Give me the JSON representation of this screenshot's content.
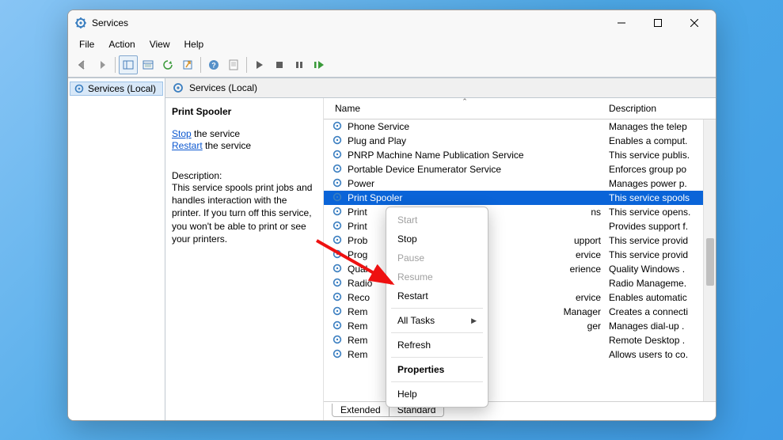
{
  "window": {
    "title": "Services"
  },
  "menu": {
    "file": "File",
    "action": "Action",
    "view": "View",
    "help": "Help"
  },
  "tree": {
    "root": "Services (Local)"
  },
  "paneHeader": "Services (Local)",
  "detail": {
    "title": "Print Spooler",
    "stop_link": "Stop",
    "stop_suffix": " the service",
    "restart_link": "Restart",
    "restart_suffix": " the service",
    "desc_head": "Description:",
    "desc_body": "This service spools print jobs and handles interaction with the printer. If you turn off this service, you won't be able to print or see your printers."
  },
  "columns": {
    "name": "Name",
    "description": "Description"
  },
  "services": [
    {
      "name": "Phone Service",
      "desc": "Manages the telep"
    },
    {
      "name": "Plug and Play",
      "desc": "Enables a comput."
    },
    {
      "name": "PNRP Machine Name Publication Service",
      "desc": "This service publis."
    },
    {
      "name": "Portable Device Enumerator Service",
      "desc": "Enforces group po"
    },
    {
      "name": "Power",
      "desc": "Manages power p."
    },
    {
      "name": "Print Spooler",
      "desc": "This service spools",
      "selected": true
    },
    {
      "name": "Print",
      "truncTo": "ns",
      "desc": "This service opens."
    },
    {
      "name": "Print",
      "truncTo": "",
      "desc": "Provides support f."
    },
    {
      "name": "Prob",
      "truncTo": "upport",
      "desc": "This service provid"
    },
    {
      "name": "Prog",
      "truncTo": "ervice",
      "desc": "This service provid"
    },
    {
      "name": "Qual",
      "truncTo": "erience",
      "desc": "Quality Windows ."
    },
    {
      "name": "Radio",
      "truncTo": "",
      "desc": "Radio Manageme."
    },
    {
      "name": "Reco",
      "truncTo": "ervice",
      "desc": "Enables automatic"
    },
    {
      "name": "Rem",
      "truncTo": "Manager",
      "desc": "Creates a connecti"
    },
    {
      "name": "Rem",
      "truncTo": "ger",
      "desc": "Manages dial-up ."
    },
    {
      "name": "Rem",
      "truncTo": "",
      "desc": "Remote Desktop ."
    },
    {
      "name": "Rem",
      "truncTo": "",
      "desc": "Allows users to co."
    }
  ],
  "contextMenu": {
    "start": "Start",
    "stop": "Stop",
    "pause": "Pause",
    "resume": "Resume",
    "restart": "Restart",
    "allTasks": "All Tasks",
    "refresh": "Refresh",
    "properties": "Properties",
    "help": "Help"
  },
  "tabs": {
    "extended": "Extended",
    "standard": "Standard"
  }
}
